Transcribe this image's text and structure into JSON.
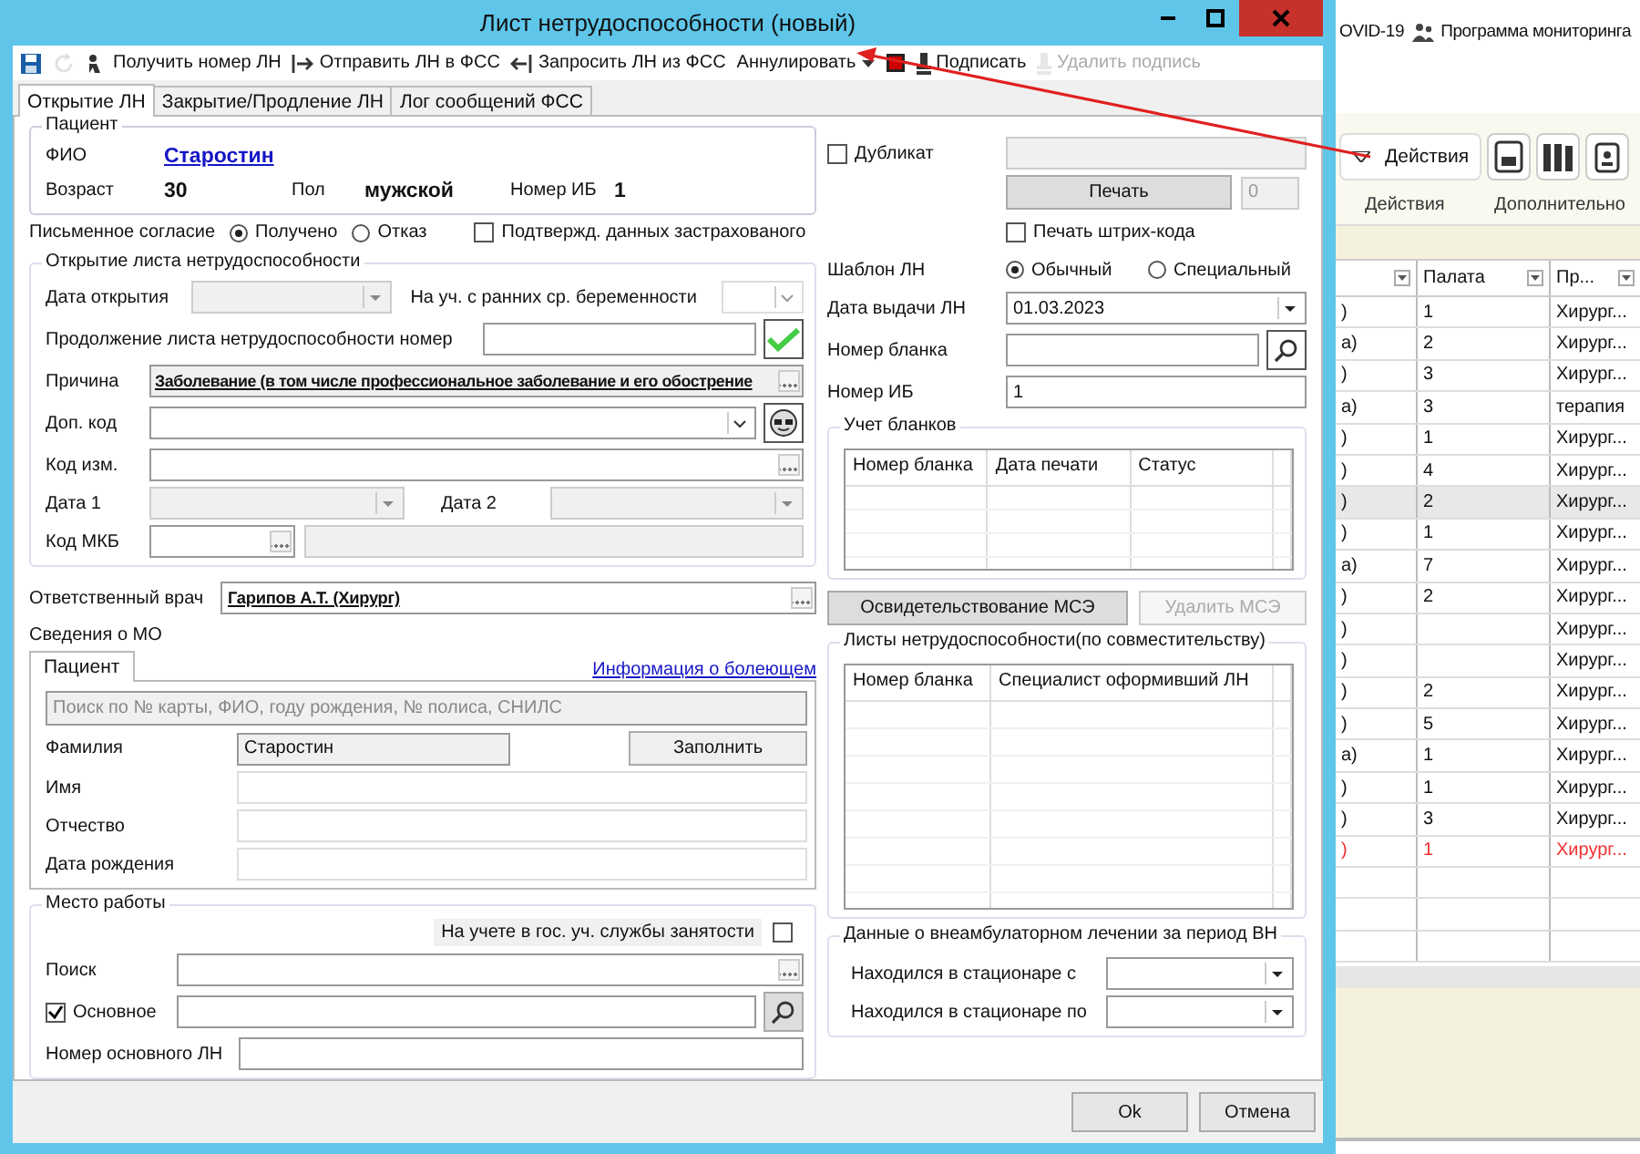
{
  "background_app": {
    "top_bar": [
      "OVID-19",
      "Программа мониторинга"
    ],
    "ribbon": {
      "dropdown_button": "Действия",
      "group_labels": [
        "Действия",
        "Дополнительно"
      ]
    },
    "table": {
      "columns": [
        "Палата",
        "Пр..."
      ],
      "rows": [
        {
          "column_1": ")",
          "ward": "1",
          "profile": "Хирург...",
          "selected": false,
          "alert": false
        },
        {
          "column_1": "а)",
          "ward": "2",
          "profile": "Хирург...",
          "selected": false,
          "alert": false
        },
        {
          "column_1": ")",
          "ward": "3",
          "profile": "Хирург...",
          "selected": false,
          "alert": false
        },
        {
          "column_1": "а)",
          "ward": "3",
          "profile": "терапия",
          "selected": false,
          "alert": false
        },
        {
          "column_1": ")",
          "ward": "1",
          "profile": "Хирург...",
          "selected": false,
          "alert": false
        },
        {
          "column_1": ")",
          "ward": "4",
          "profile": "Хирург...",
          "selected": false,
          "alert": false
        },
        {
          "column_1": ")",
          "ward": "2",
          "profile": "Хирург...",
          "selected": true,
          "alert": false
        },
        {
          "column_1": ")",
          "ward": "1",
          "profile": "Хирург...",
          "selected": false,
          "alert": false
        },
        {
          "column_1": "а)",
          "ward": "7",
          "profile": "Хирург...",
          "selected": false,
          "alert": false
        },
        {
          "column_1": ")",
          "ward": "2",
          "profile": "Хирург...",
          "selected": false,
          "alert": false
        },
        {
          "column_1": ")",
          "profile": "Хирург...",
          "selected": false,
          "alert": false
        },
        {
          "column_1": ")",
          "profile": "Хирург...",
          "selected": false,
          "alert": false
        },
        {
          "column_1": ")",
          "ward": "2",
          "profile": "Хирург...",
          "selected": false,
          "alert": false
        },
        {
          "column_1": ")",
          "ward": "5",
          "profile": "Хирург...",
          "selected": false,
          "alert": false
        },
        {
          "column_1": "а)",
          "ward": "1",
          "profile": "Хирург...",
          "selected": false,
          "alert": false
        },
        {
          "column_1": ")",
          "ward": "1",
          "profile": "Хирург...",
          "selected": false,
          "alert": false
        },
        {
          "column_1": ")",
          "ward": "3",
          "profile": "Хирург...",
          "selected": false,
          "alert": false
        },
        {
          "column_1": ")",
          "ward": "1",
          "profile": "Хирург...",
          "selected": false,
          "alert": true
        }
      ]
    }
  },
  "dialog": {
    "title": "Лист нетрудоспособности (новый)",
    "toolbar": [
      {
        "kind": "save",
        "disabled": false
      },
      {
        "kind": "refresh",
        "disabled": true
      },
      {
        "kind": "fetch",
        "label": "Получить номер ЛН",
        "disabled": false
      },
      {
        "kind": "send",
        "label": "Отправить ЛН в ФСС",
        "disabled": false
      },
      {
        "kind": "request",
        "label": "Запросить ЛН из ФСС",
        "disabled": false
      },
      {
        "kind": "menu",
        "label": "Аннулировать",
        "disabled": false
      },
      {
        "kind": "stop",
        "disabled": false
      },
      {
        "kind": "sign",
        "label": "Подписать",
        "disabled": false
      },
      {
        "kind": "unsign",
        "label": "Удалить подпись",
        "disabled": true
      }
    ],
    "tabs": [
      {
        "label": "Открытие ЛН",
        "selected": true
      },
      {
        "label": "Закрытие/Продление ЛН",
        "selected": false
      },
      {
        "label": "Лог сообщений ФСС",
        "selected": false
      }
    ],
    "patient": {
      "legend": "Пациент",
      "fio_label": "ФИО",
      "fio": "Старостин",
      "age_label": "Возраст",
      "age": "30",
      "sex_label": "Пол",
      "sex": "мужской",
      "ib_label": "Номер ИБ",
      "ib": "1"
    },
    "consent": {
      "label": "Письменное согласие",
      "options": [
        {
          "label": "Получено",
          "selected": true
        },
        {
          "label": "Отказ",
          "selected": false
        }
      ],
      "confirm": {
        "label": "Подтвержд. данных застрахованого",
        "checked": false
      }
    },
    "opening": {
      "legend": "Открытие листа нетрудоспособности",
      "date_label": "Дата открытия",
      "pregnancy_label": "На уч. с ранних ср. беременности",
      "continuation_label": "Продолжение листа нетрудоспособности номер",
      "reason_label": "Причина",
      "reason": "Заболевание (в том числе профессиональное заболевание и его обострение",
      "extra_code_label": "Доп. код",
      "change_code_label": "Код изм.",
      "date1_label": "Дата 1",
      "date2_label": "Дата 2",
      "mkb_label": "Код МКБ"
    },
    "doctor": {
      "label": "Ответственный врач",
      "value": "Гарипов А.Т. (Хирург)"
    },
    "mo_label": "Сведения о МО",
    "mo_panel": {
      "tab": "Пациент",
      "link": "Информация о болеющем",
      "search_placeholder": "Поиск по № карты, ФИО, году рождения, № полиса, СНИЛС",
      "surname_label": "Фамилия",
      "surname": "Старостин",
      "fill_button": "Заполнить",
      "name_label": "Имя",
      "patronymic_label": "Отчество",
      "birth_label": "Дата рождения"
    },
    "workplace": {
      "legend": "Место работы",
      "employment": {
        "label": "На учете в гос. уч. службы занятости",
        "checked": false
      },
      "search_label": "Поиск",
      "main": {
        "label": "Основное",
        "checked": true
      },
      "main_number_label": "Номер основного ЛН"
    },
    "right": {
      "duplicate": {
        "label": "Дубликат",
        "checked": false
      },
      "print_button": "Печать",
      "copies": "0",
      "barcode": {
        "label": "Печать штрих-кода",
        "checked": false
      },
      "template_label": "Шаблон ЛН",
      "templates": [
        {
          "label": "Обычный",
          "selected": true
        },
        {
          "label": "Специальный",
          "selected": false
        }
      ],
      "issue_label": "Дата выдачи ЛН",
      "issue_date": "01.03.2023",
      "blank_label": "Номер бланка",
      "ib_label": "Номер ИБ",
      "ib": "1",
      "blanks": {
        "legend": "Учет бланков",
        "columns": [
          "Номер бланка",
          "Дата печати",
          "Статус"
        ]
      },
      "mse_button": "Освидетельствование МСЭ",
      "delete_mse_button": "Удалить МСЭ",
      "parallel": {
        "legend": "Листы нетрудоспособности(по совместительству)",
        "columns": [
          "Номер бланка",
          "Специалист оформивший ЛН"
        ]
      },
      "hospital": {
        "legend": "Данные о внеамбулаторном лечении за период ВН",
        "from_label": "Находился в стационаре с",
        "to_label": "Находился в стационаре по"
      }
    },
    "buttons": [
      "Ok",
      "Отмена"
    ]
  }
}
